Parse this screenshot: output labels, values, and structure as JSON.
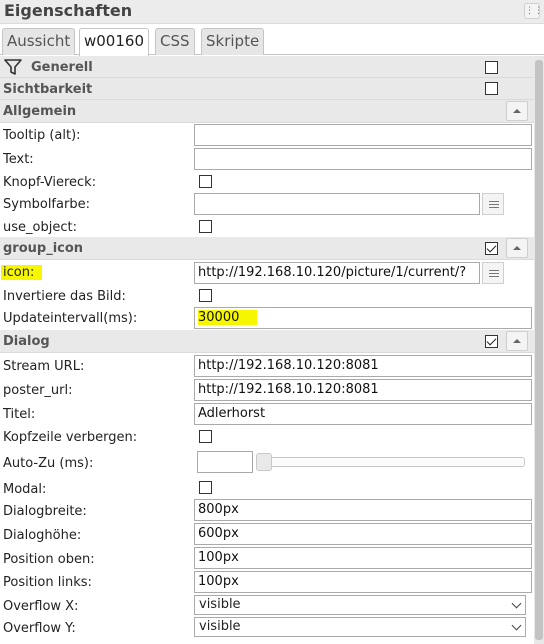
{
  "panel_title": "Eigenschaften",
  "tabs": [
    "Aussicht",
    "w00160",
    "CSS",
    "Skripte"
  ],
  "groups": {
    "generell": "Generell",
    "sichtbarkeit": "Sichtbarkeit",
    "allgemein": "Allgemein",
    "group_icon": "group_icon",
    "dialog": "Dialog"
  },
  "allgemein": {
    "tooltip_label": "Tooltip (alt):",
    "tooltip_value": "",
    "text_label": "Text:",
    "text_value": "",
    "knopf_label": "Knopf-Viereck:",
    "symbolfarbe_label": "Symbolfarbe:",
    "symbolfarbe_value": "",
    "use_object_label": "use_object:"
  },
  "group_icon": {
    "icon_label": "icon:",
    "icon_value": "http://192.168.10.120/picture/1/current/?",
    "invert_label": "Invertiere das Bild:",
    "update_label": "Updateintervall(ms):",
    "update_value": "30000"
  },
  "dialog": {
    "stream_label": "Stream URL:",
    "stream_value": "http://192.168.10.120:8081",
    "poster_label": "poster_url:",
    "poster_value": "http://192.168.10.120:8081",
    "titel_label": "Titel:",
    "titel_value": "Adlerhorst",
    "kopfzeile_label": "Kopfzeile verbergen:",
    "autozu_label": "Auto-Zu (ms):",
    "autozu_value": "",
    "modal_label": "Modal:",
    "breite_label": "Dialogbreite:",
    "breite_value": "800px",
    "hoehe_label": "Dialoghöhe:",
    "hoehe_value": "600px",
    "oben_label": "Position oben:",
    "oben_value": "100px",
    "links_label": "Position links:",
    "links_value": "100px",
    "overflow_x_label": "Overflow X:",
    "overflow_x_value": "visible",
    "overflow_y_label": "Overflow Y:",
    "overflow_y_value": "visible"
  },
  "highlight_color": "#f6f600"
}
